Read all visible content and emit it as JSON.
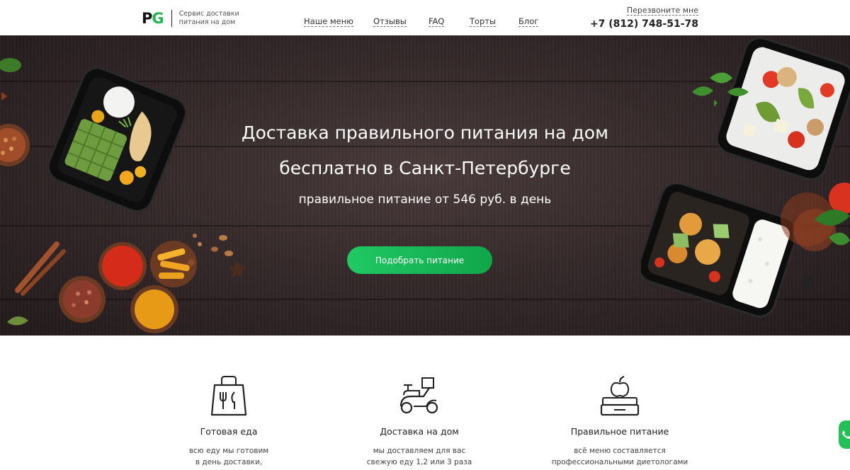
{
  "header": {
    "logo_p": "P",
    "logo_g": "G",
    "tagline": "Сервис доставки питания на дом",
    "nav": [
      {
        "label": "Наше меню"
      },
      {
        "label": "Отзывы"
      },
      {
        "label": "FAQ"
      },
      {
        "label": "Торты"
      },
      {
        "label": "Блог"
      }
    ],
    "callback_label": "Перезвоните мне",
    "phone": "+7 (812) 748-51-78"
  },
  "hero": {
    "title_line1": "Доставка правильного питания на дом",
    "title_line2": "бесплатно в Санкт-Петербурге",
    "subtitle": "правильное питание от 546 руб. в день",
    "cta_label": "Подобрать питание"
  },
  "features": [
    {
      "icon": "shopping-bag-utensils-icon",
      "title": "Готовая еда",
      "text_line1": "всю еду мы готовим",
      "text_line2": "в день доставки,"
    },
    {
      "icon": "delivery-scooter-icon",
      "title": "Доставка на дом",
      "text_line1": "мы доставляем для вас",
      "text_line2": "свежую еду 1,2 или 3 раза"
    },
    {
      "icon": "apple-lunchbox-icon",
      "title": "Правильное питание",
      "text_line1": "всё меню составляется",
      "text_line2": "профессиональными диетологами"
    }
  ],
  "colors": {
    "brand_green": "#1fb84f",
    "cta_green": "#16b553",
    "hero_bg": "#362a2b"
  },
  "floating": {
    "icon": "phone-icon"
  }
}
